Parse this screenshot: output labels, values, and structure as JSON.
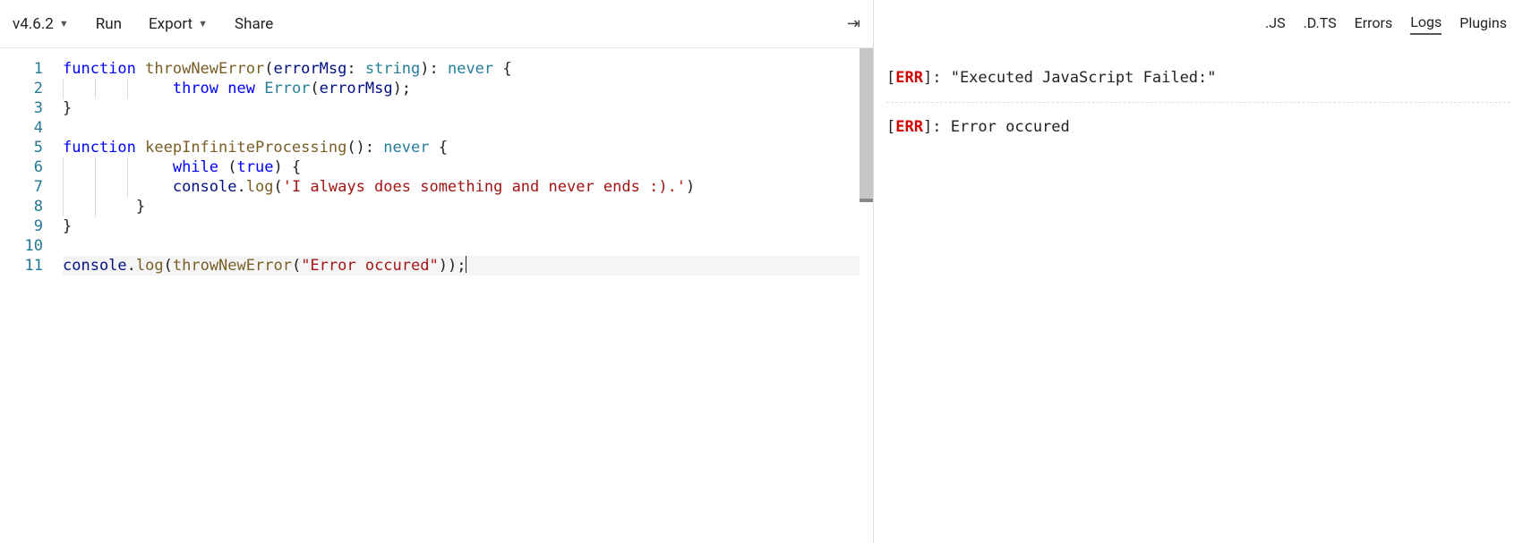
{
  "toolbar": {
    "version": "v4.6.2",
    "run": "Run",
    "export": "Export",
    "share": "Share"
  },
  "editor": {
    "lines": [
      {
        "n": 1,
        "indents": 0,
        "tokens": [
          {
            "t": "kw",
            "v": "function"
          },
          {
            "t": "sp",
            "v": " "
          },
          {
            "t": "fn",
            "v": "throwNewError"
          },
          {
            "t": "punc",
            "v": "("
          },
          {
            "t": "id",
            "v": "errorMsg"
          },
          {
            "t": "punc",
            "v": ": "
          },
          {
            "t": "type",
            "v": "string"
          },
          {
            "t": "punc",
            "v": "): "
          },
          {
            "t": "type",
            "v": "never"
          },
          {
            "t": "punc",
            "v": " {"
          }
        ]
      },
      {
        "n": 2,
        "indents": 3,
        "pad": "            ",
        "tokens": [
          {
            "t": "kw",
            "v": "throw"
          },
          {
            "t": "sp",
            "v": " "
          },
          {
            "t": "kw",
            "v": "new"
          },
          {
            "t": "sp",
            "v": " "
          },
          {
            "t": "class",
            "v": "Error"
          },
          {
            "t": "punc",
            "v": "("
          },
          {
            "t": "id",
            "v": "errorMsg"
          },
          {
            "t": "punc",
            "v": ");"
          }
        ]
      },
      {
        "n": 3,
        "indents": 0,
        "tokens": [
          {
            "t": "punc",
            "v": "}"
          }
        ]
      },
      {
        "n": 4,
        "indents": 0,
        "tokens": []
      },
      {
        "n": 5,
        "indents": 0,
        "tokens": [
          {
            "t": "kw",
            "v": "function"
          },
          {
            "t": "sp",
            "v": " "
          },
          {
            "t": "fn",
            "v": "keepInfiniteProcessing"
          },
          {
            "t": "punc",
            "v": "(): "
          },
          {
            "t": "type",
            "v": "never"
          },
          {
            "t": "punc",
            "v": " {"
          }
        ]
      },
      {
        "n": 6,
        "indents": 3,
        "pad": "            ",
        "tokens": [
          {
            "t": "kw",
            "v": "while"
          },
          {
            "t": "punc",
            "v": " ("
          },
          {
            "t": "kw",
            "v": "true"
          },
          {
            "t": "punc",
            "v": ") {"
          }
        ]
      },
      {
        "n": 7,
        "indents": 3,
        "pad": "         ",
        "tokens": [
          {
            "t": "id",
            "v": "console"
          },
          {
            "t": "punc",
            "v": "."
          },
          {
            "t": "fn",
            "v": "log"
          },
          {
            "t": "punc",
            "v": "("
          },
          {
            "t": "str",
            "v": "'I always does something and never ends :).'"
          },
          {
            "t": "punc",
            "v": ")"
          }
        ]
      },
      {
        "n": 8,
        "indents": 2,
        "pad": "   ",
        "tokens": [
          {
            "t": "punc",
            "v": "}"
          }
        ]
      },
      {
        "n": 9,
        "indents": 0,
        "tokens": [
          {
            "t": "punc",
            "v": "}"
          }
        ]
      },
      {
        "n": 10,
        "indents": 0,
        "tokens": []
      },
      {
        "n": 11,
        "indents": 0,
        "current": true,
        "cursor": true,
        "tokens": [
          {
            "t": "id",
            "v": "console"
          },
          {
            "t": "punc",
            "v": "."
          },
          {
            "t": "fn",
            "v": "log"
          },
          {
            "t": "punc",
            "v": "("
          },
          {
            "t": "fn",
            "v": "throwNewError"
          },
          {
            "t": "punc",
            "v": "("
          },
          {
            "t": "str",
            "v": "\"Error occured\""
          },
          {
            "t": "punc",
            "v": "));"
          }
        ]
      }
    ]
  },
  "output_tabs": {
    "js": ".JS",
    "dts": ".D.TS",
    "errors": "Errors",
    "logs": "Logs",
    "plugins": "Plugins",
    "active": "logs"
  },
  "logs": [
    {
      "tag": "ERR",
      "msg": "\"Executed JavaScript Failed:\""
    },
    {
      "tag": "ERR",
      "msg": "Error occured"
    }
  ]
}
